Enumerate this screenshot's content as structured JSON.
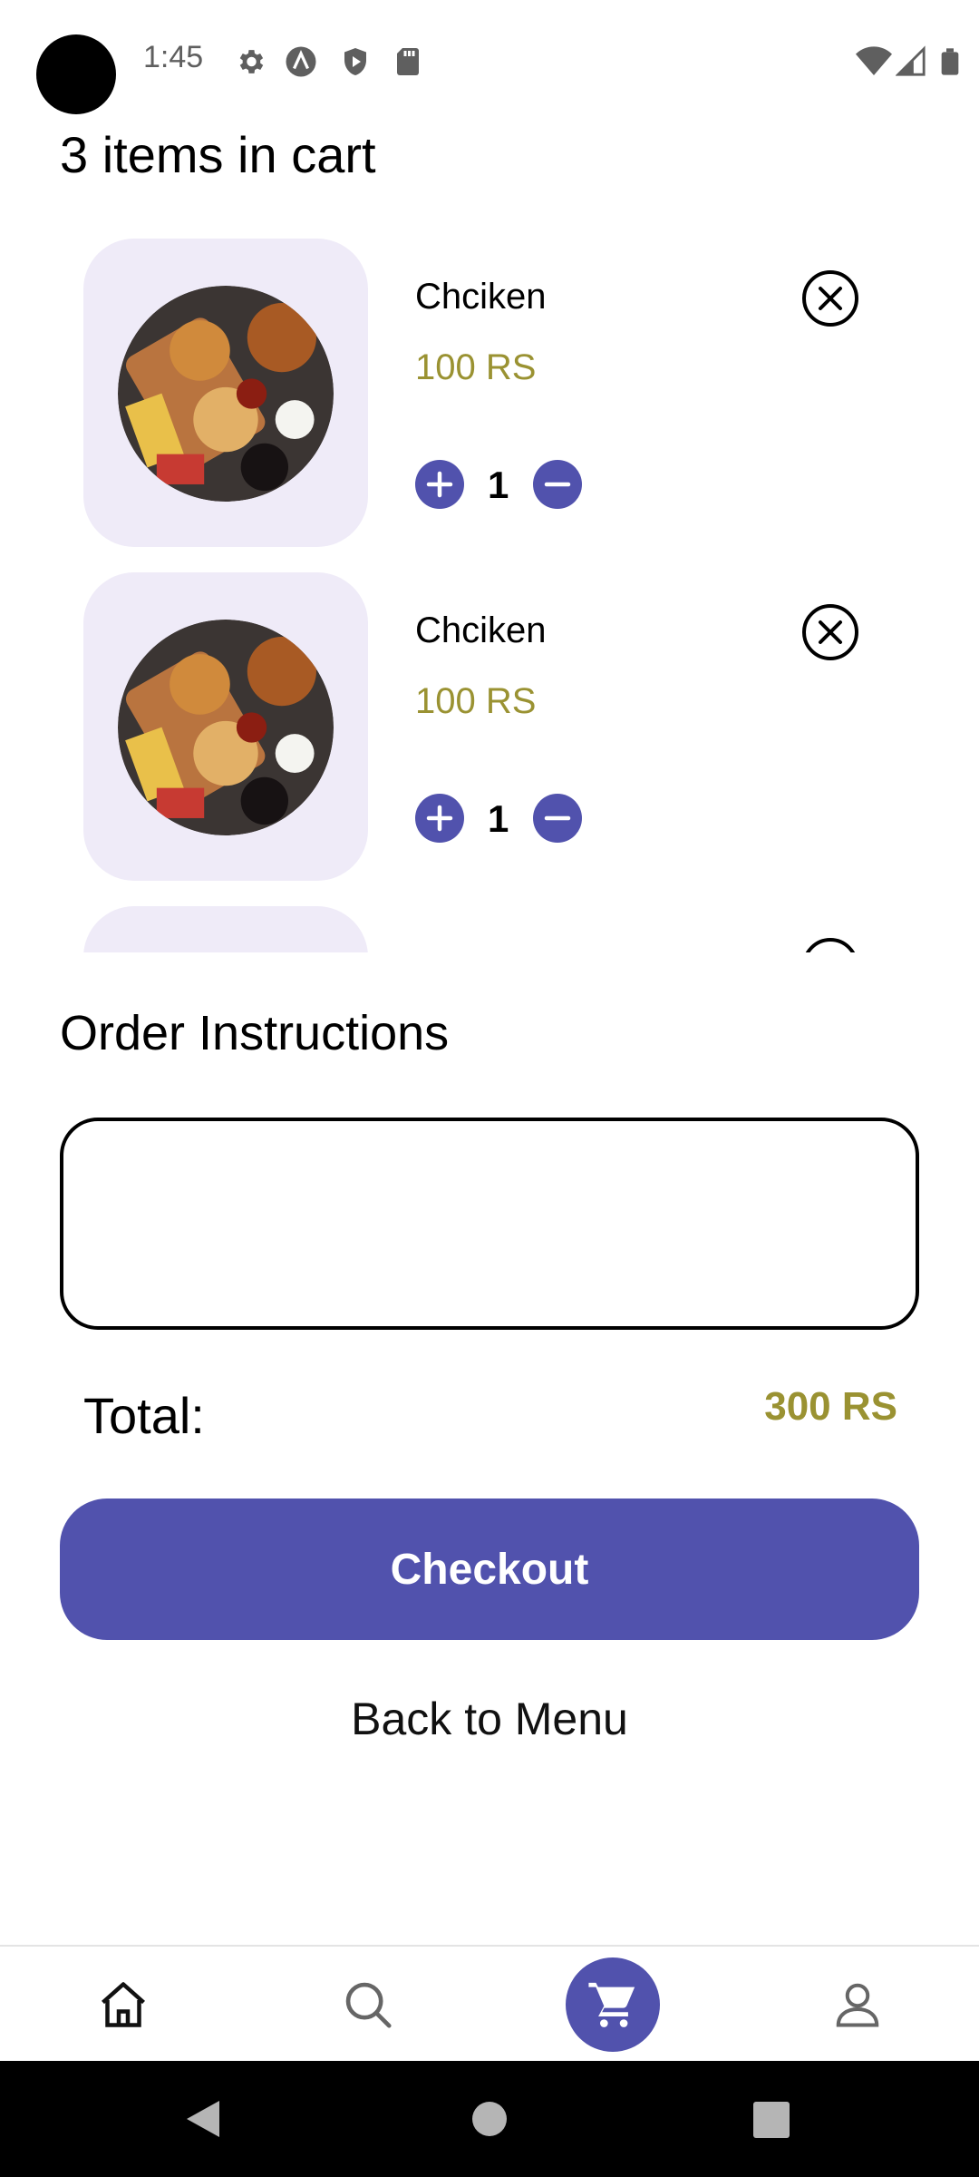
{
  "status_bar": {
    "time": "1:45",
    "icons": [
      "settings-icon",
      "a-icon",
      "shield-icon",
      "sd-card-icon"
    ],
    "right_icons": [
      "wifi-icon",
      "signal-icon",
      "battery-icon"
    ]
  },
  "cart": {
    "title": "3 items in cart",
    "items": [
      {
        "name": "Chciken",
        "price": "100 RS",
        "quantity": "1"
      },
      {
        "name": "Chciken",
        "price": "100 RS",
        "quantity": "1"
      },
      {
        "name": "",
        "price": "",
        "quantity": ""
      }
    ]
  },
  "order": {
    "instructions_title": "Order Instructions",
    "instructions_value": "",
    "total_label": "Total:",
    "total_value": "300 RS",
    "checkout_label": "Checkout",
    "back_label": "Back to Menu"
  },
  "bottom_nav": {
    "items": [
      "home-icon",
      "search-icon",
      "cart-icon",
      "profile-icon"
    ],
    "active": "cart-icon"
  },
  "colors": {
    "accent": "#5152ad",
    "price": "#9a9232",
    "thumb_bg": "#efebf8"
  }
}
